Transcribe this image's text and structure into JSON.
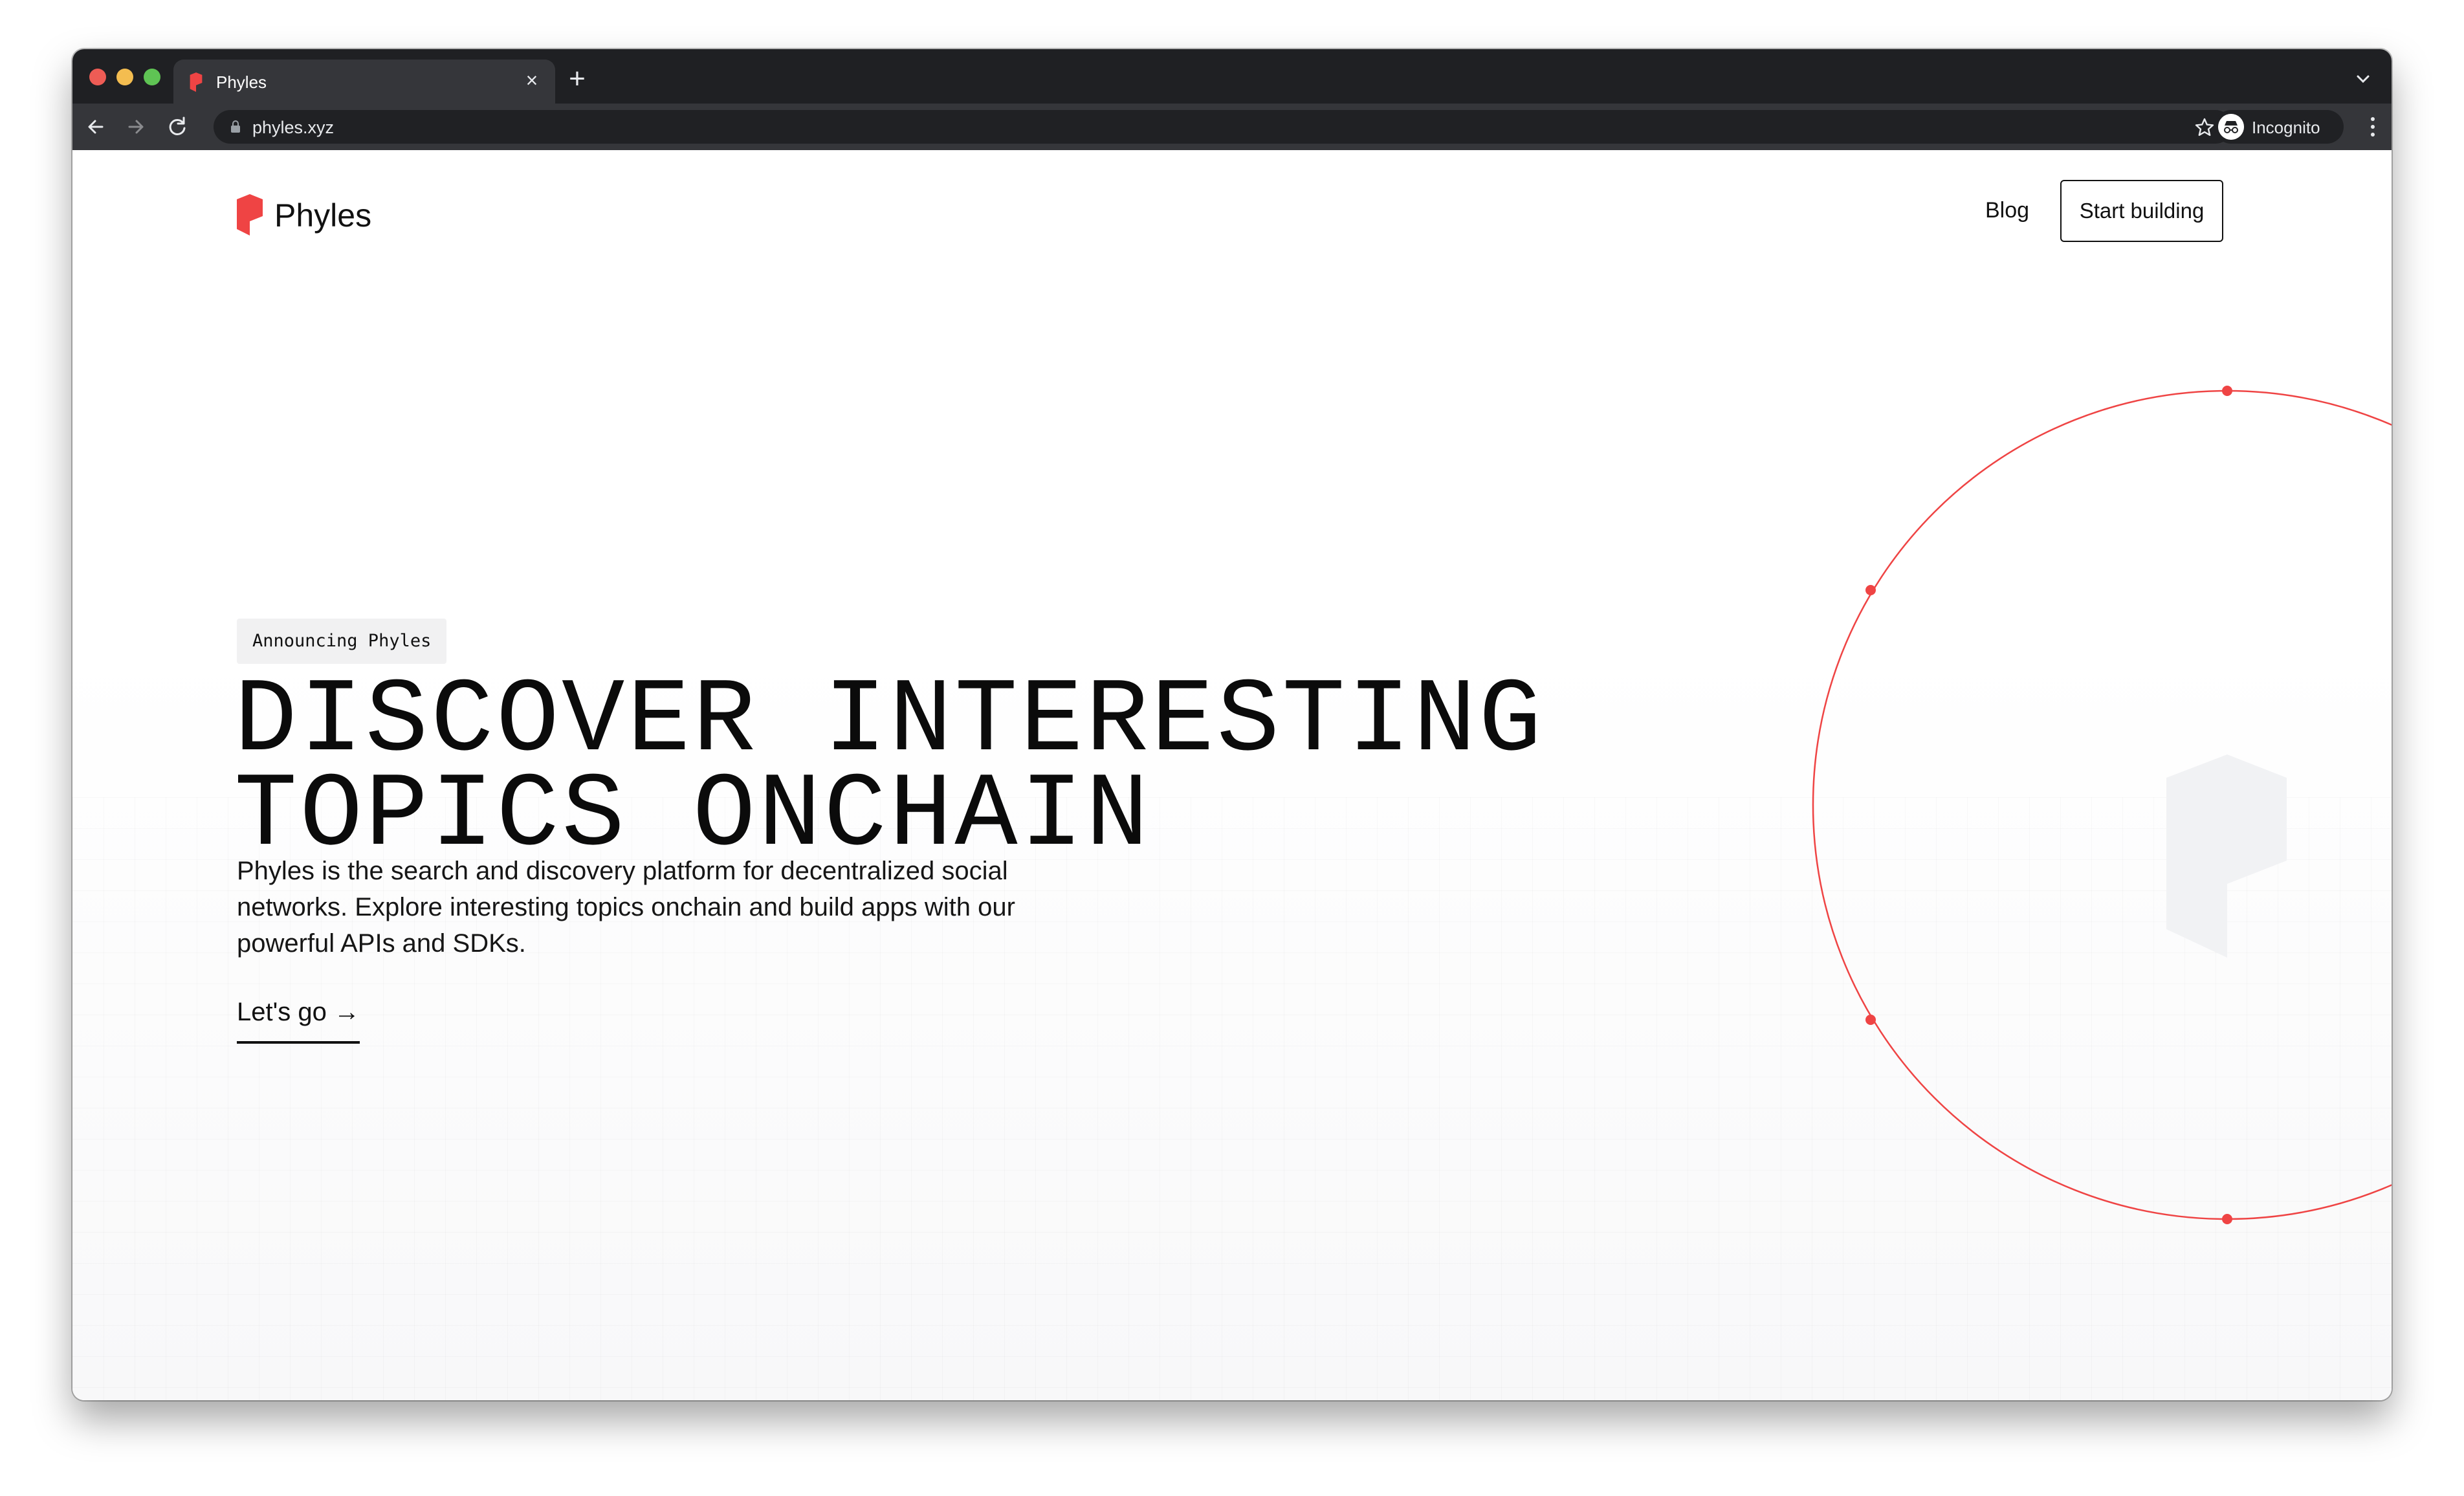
{
  "browser": {
    "tab_title": "Phyles",
    "url": "phyles.xyz",
    "profile_label": "Incognito"
  },
  "site": {
    "logo_text": "Phyles",
    "nav": {
      "blog_label": "Blog",
      "start_label": "Start building"
    },
    "hero": {
      "badge": "Announcing Phyles",
      "headline_line1": "DISCOVER INTERESTING",
      "headline_line2": "TOPICS ONCHAIN",
      "subtitle": "Phyles is the search and discovery platform for decentralized social networks. Explore interesting topics onchain and build apps with our powerful APIs and SDKs.",
      "cta_label": "Let's go →"
    }
  },
  "colors": {
    "brand_red": "#ef4444",
    "text": "#111111"
  },
  "icons": [
    "back-arrow-icon",
    "forward-arrow-icon",
    "reload-icon",
    "lock-icon",
    "star-icon",
    "side-panel-icon",
    "incognito-icon",
    "more-vert-icon",
    "close-icon",
    "plus-icon",
    "chevron-down-icon"
  ]
}
